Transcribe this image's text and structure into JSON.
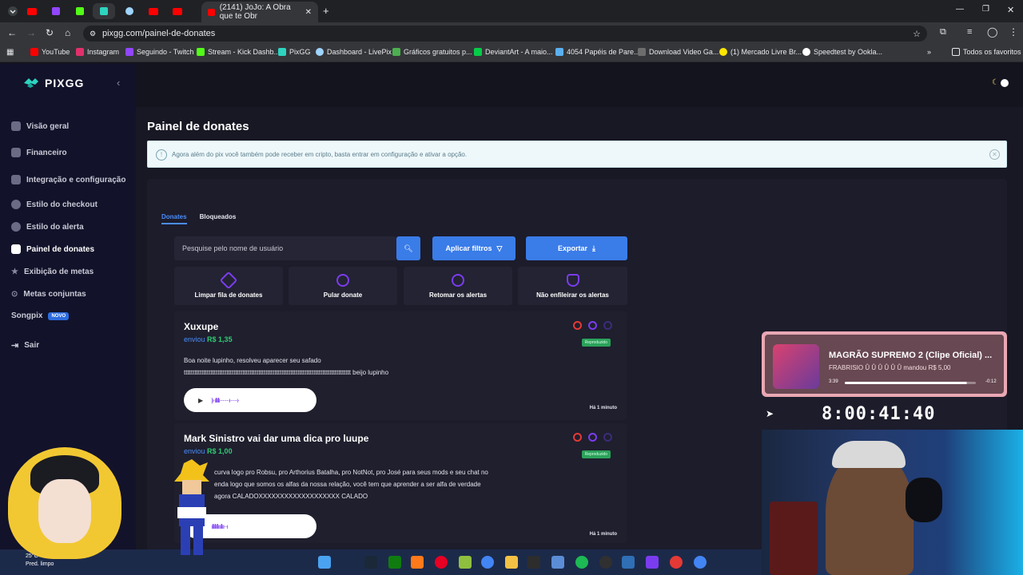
{
  "browser": {
    "active_tab_title": "(2141) JoJo: A Obra que te Obr",
    "url": "pixgg.com/painel-de-donates",
    "bookmarks": [
      "YouTube",
      "Instagram",
      "Seguindo - Twitch",
      "Stream - Kick Dashb...",
      "PixGG",
      "Dashboard - LivePix",
      "Gráficos gratuitos p...",
      "DeviantArt - A maio...",
      "4054 Papéis de Pare...",
      "Download Video Ga...",
      "(1) Mercado Livre Br...",
      "Speedtest by Ookla...",
      "Todos os favoritos"
    ]
  },
  "app": {
    "logo": "PIXGG"
  },
  "sidebar": {
    "items": [
      {
        "label": "Visão geral"
      },
      {
        "label": "Financeiro"
      },
      {
        "label": "Integração e configuração"
      },
      {
        "label": "Estilo do checkout"
      },
      {
        "label": "Estilo do alerta"
      },
      {
        "label": "Painel de donates"
      },
      {
        "label": "Exibição de metas"
      },
      {
        "label": "Metas conjuntas"
      },
      {
        "label": "Songpix"
      },
      {
        "label": "Sair"
      }
    ],
    "new_badge": "NOVO"
  },
  "main": {
    "title": "Painel de donates",
    "banner": "Agora além do pix você também pode receber em cripto, basta entrar em configuração e ativar a opção.",
    "tabs": [
      "Donates",
      "Bloqueados"
    ],
    "search_placeholder": "Pesquise pelo nome de usuário",
    "apply_filters": "Aplicar filtros",
    "export": "Exportar",
    "actions": [
      "Limpar fila de donates",
      "Pular donate",
      "Retomar os alertas",
      "Não enfileirar os alertas"
    ],
    "sent_label": "enviou",
    "status_label": "Reproduzido",
    "donates": [
      {
        "name": "Xuxupe",
        "amount": "R$ 1,35",
        "message_line1": "Boa noite lupinho, resolveu aparecer seu safado",
        "message_line2": "tttttttttttttttttttttttttttttttttttttttttttttttttttttttttttttttttttttttttttttttttttttttttttttt beijo lupinho",
        "time": "Há 1 minuto"
      },
      {
        "name": "Mark Sinistro vai dar uma dica pro luupe",
        "amount": "R$ 1,00",
        "message_line1": "curva logo pro Robsu, pro Arthorius Batalha, pro NotNot, pro José para seus mods e seu chat no",
        "message_line2": "enda logo que somos os alfas da nossa relação, você tem que aprender a ser alfa de verdade",
        "message_line3": "agora CALADOXXXXXXXXXXXXXXXXXXX CALADO",
        "time": "Há 1 minuto"
      }
    ]
  },
  "overlay": {
    "song_title": "MAGRÃO SUPREMO 2 (Clipe Oficial) ...",
    "song_sub": "FRABRISIO Û Û Û Û Û Û mandou R$ 5,00",
    "time_elapsed": "3:39",
    "time_left": "-0:12",
    "progress": 0.93,
    "timer": "8:00:41:40"
  },
  "weather": {
    "temp": "25°C",
    "desc": "Pred. limpo"
  }
}
